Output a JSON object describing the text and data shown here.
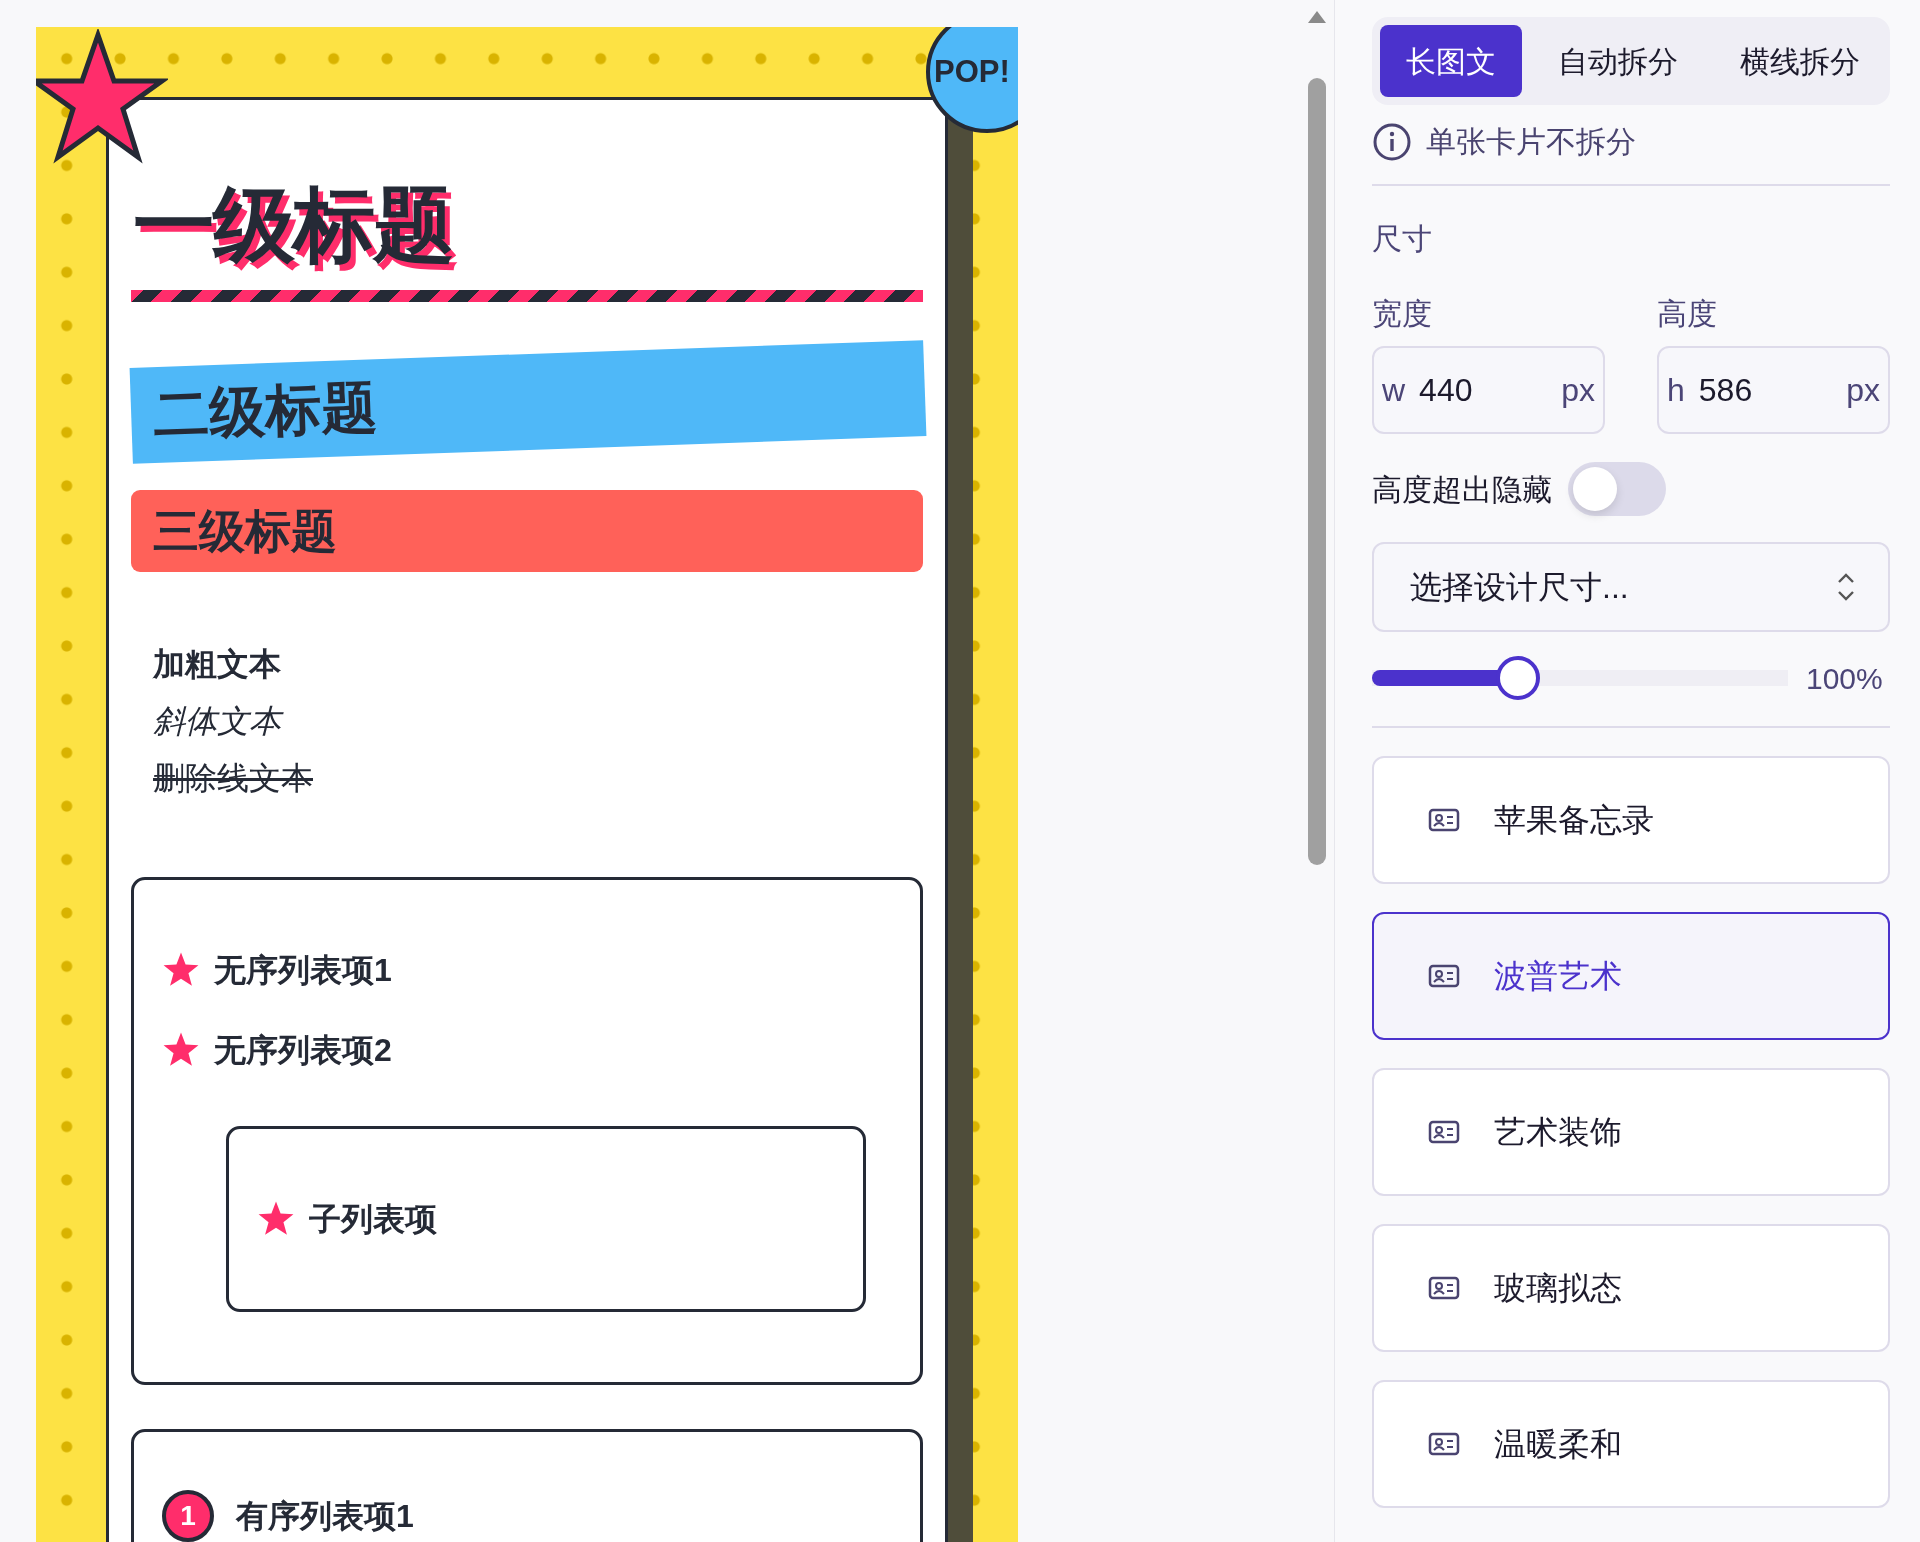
{
  "preview": {
    "badge": "POP!",
    "heading_1": "一级标题",
    "heading_2": "二级标题",
    "heading_3": "三级标题",
    "bold_text": "加粗文本",
    "italic_text": "斜体文本",
    "strikethrough_text": "删除线文本",
    "unordered_list": [
      {
        "text": "无序列表项1"
      },
      {
        "text": "无序列表项2",
        "children": [
          {
            "text": "子列表项"
          }
        ]
      }
    ],
    "ordered_list": [
      {
        "number": "1",
        "text": "有序列表项1"
      }
    ]
  },
  "tabs": [
    {
      "label": "长图文",
      "selected": true
    },
    {
      "label": "自动拆分",
      "selected": false
    },
    {
      "label": "横线拆分",
      "selected": false
    }
  ],
  "hint": "单张卡片不拆分",
  "size": {
    "title": "尺寸",
    "width": {
      "label": "宽度",
      "prefix": "w",
      "value": "440",
      "unit": "px"
    },
    "height": {
      "label": "高度",
      "prefix": "h",
      "value": "586",
      "unit": "px"
    },
    "overflow_toggle": {
      "label": "高度超出隐藏",
      "on": false
    },
    "design_size_select": {
      "placeholder": "选择设计尺寸..."
    },
    "zoom_slider": {
      "level": 0.35,
      "reading": "100%"
    }
  },
  "templates": [
    {
      "label": "苹果备忘录",
      "selected": false
    },
    {
      "label": "波普艺术",
      "selected": true
    },
    {
      "label": "艺术装饰",
      "selected": false
    },
    {
      "label": "玻璃拟态",
      "selected": false
    },
    {
      "label": "温暖柔和",
      "selected": false
    }
  ]
}
